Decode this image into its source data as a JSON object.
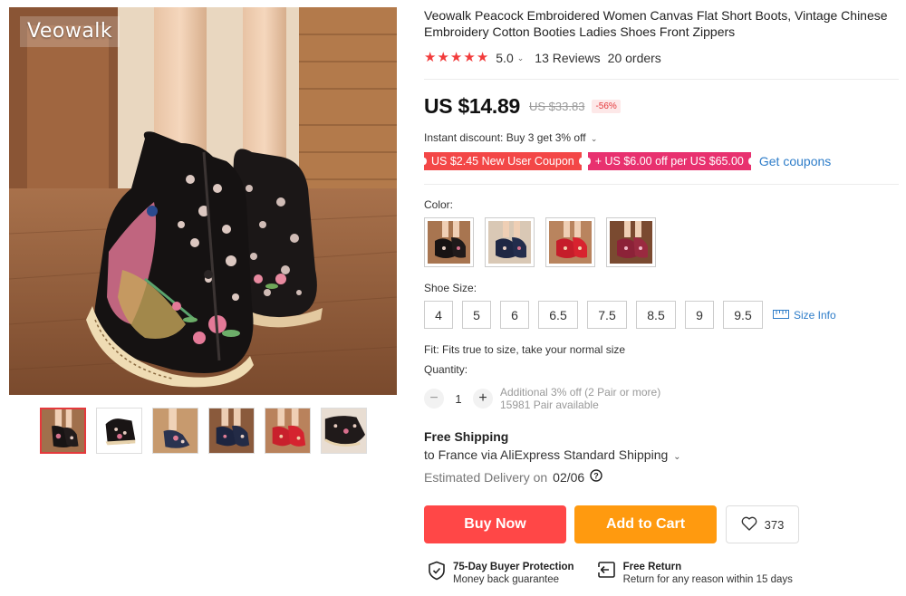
{
  "gallery": {
    "brand_watermark": "Veowalk",
    "thumbnails": [
      "black-boot-pair",
      "black-boot-side",
      "blue-boot-worn",
      "navy-boot-worn",
      "red-boot-worn",
      "black-boot-sole"
    ]
  },
  "product": {
    "title": "Veowalk Peacock Embroidered Women Canvas Flat Short Boots, Vintage Chinese Embroidery Cotton Booties Ladies Shoes Front Zippers",
    "rating": {
      "stars": 5,
      "score": "5.0",
      "reviews": "13 Reviews",
      "orders": "20 orders"
    },
    "price": {
      "current": "US $14.89",
      "original": "US $33.83",
      "discount": "-56%"
    },
    "instant_discount": "Instant discount: Buy 3 get 3% off",
    "coupons": {
      "new_user": "US $2.45 New User Coupon",
      "store": "US $6.00 off per US $65.00",
      "get_link": "Get coupons"
    }
  },
  "options": {
    "color_label": "Color:",
    "colors": [
      "black",
      "navy",
      "red",
      "wine-red"
    ],
    "size_label": "Shoe Size:",
    "sizes": [
      "4",
      "5",
      "6",
      "6.5",
      "7.5",
      "8.5",
      "9",
      "9.5"
    ],
    "size_info": "Size Info",
    "fit_note": "Fit: Fits true to size, take your normal size"
  },
  "quantity": {
    "label": "Quantity:",
    "value": "1",
    "note_discount": "Additional 3% off (2 Pair or more)",
    "note_available": "15981 Pair available"
  },
  "shipping": {
    "title": "Free Shipping",
    "destination": "to France via AliExpress Standard Shipping",
    "delivery_prefix": "Estimated Delivery on",
    "delivery_date": "02/06"
  },
  "actions": {
    "buy_now": "Buy Now",
    "add_to_cart": "Add to Cart",
    "wishlist_count": "373"
  },
  "guarantees": {
    "protection_title": "75-Day Buyer Protection",
    "protection_sub": "Money back guarantee",
    "return_title": "Free Return",
    "return_sub": "Return for any reason within 15 days"
  },
  "colors": {
    "accent_red": "#ff4747",
    "accent_orange": "#ff9a0f",
    "link_blue": "#2e7dc9",
    "coupon_pink": "#e8316f"
  }
}
